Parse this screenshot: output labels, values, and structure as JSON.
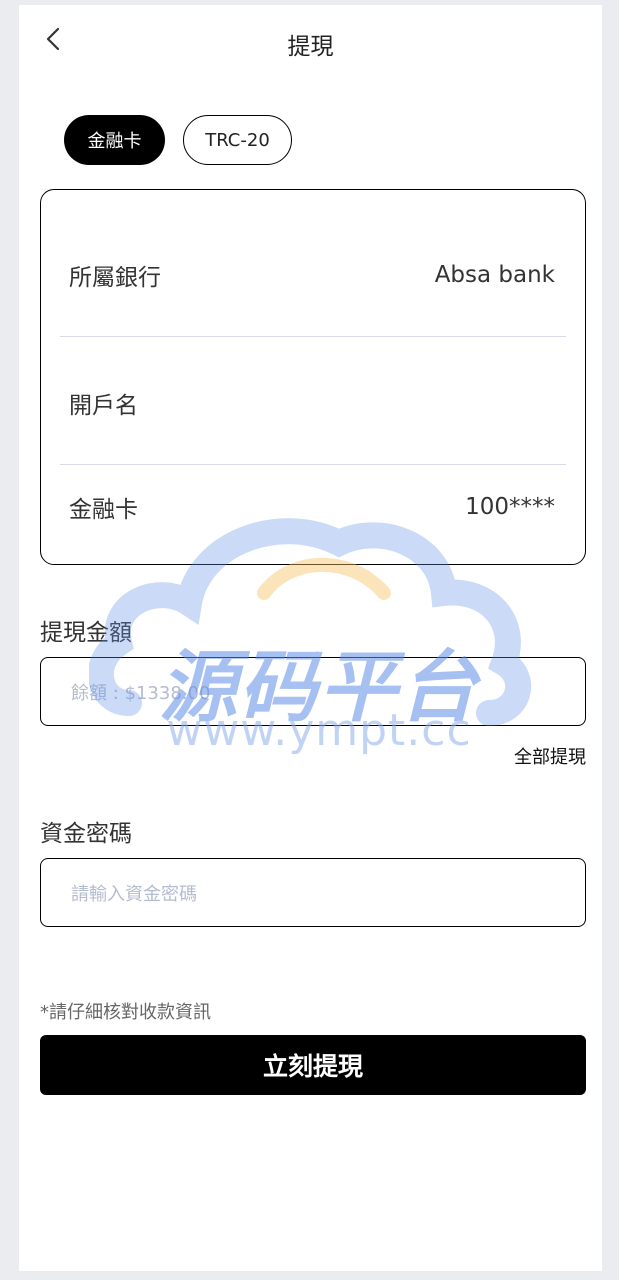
{
  "header": {
    "title": "提現",
    "back_icon": "chevron-left-icon"
  },
  "tabs": [
    {
      "label": "金融卡",
      "active": true
    },
    {
      "label": "TRC-20",
      "active": false
    }
  ],
  "bank_card": {
    "bank_label": "所屬銀行",
    "bank_value": "Absa bank",
    "account_name_label": "開戶名",
    "account_name_value": "",
    "card_label": "金融卡",
    "card_value": "100****"
  },
  "amount": {
    "label": "提現金額",
    "placeholder": "餘額 : $1338.00",
    "withdraw_all": "全部提現"
  },
  "password": {
    "label": "資金密碼",
    "placeholder": "請輸入資金密碼"
  },
  "note": "*請仔細核對收款資訊",
  "submit_label": "立刻提現",
  "watermark": {
    "title": "源码平台",
    "url": "www.ympt.cc"
  },
  "colors": {
    "primary": "#000000",
    "placeholder": "#b4bccf",
    "divider": "#d9dbea",
    "background": "#ebecef",
    "watermark_blue": "#5f8de8",
    "watermark_orange": "#f5c060"
  }
}
